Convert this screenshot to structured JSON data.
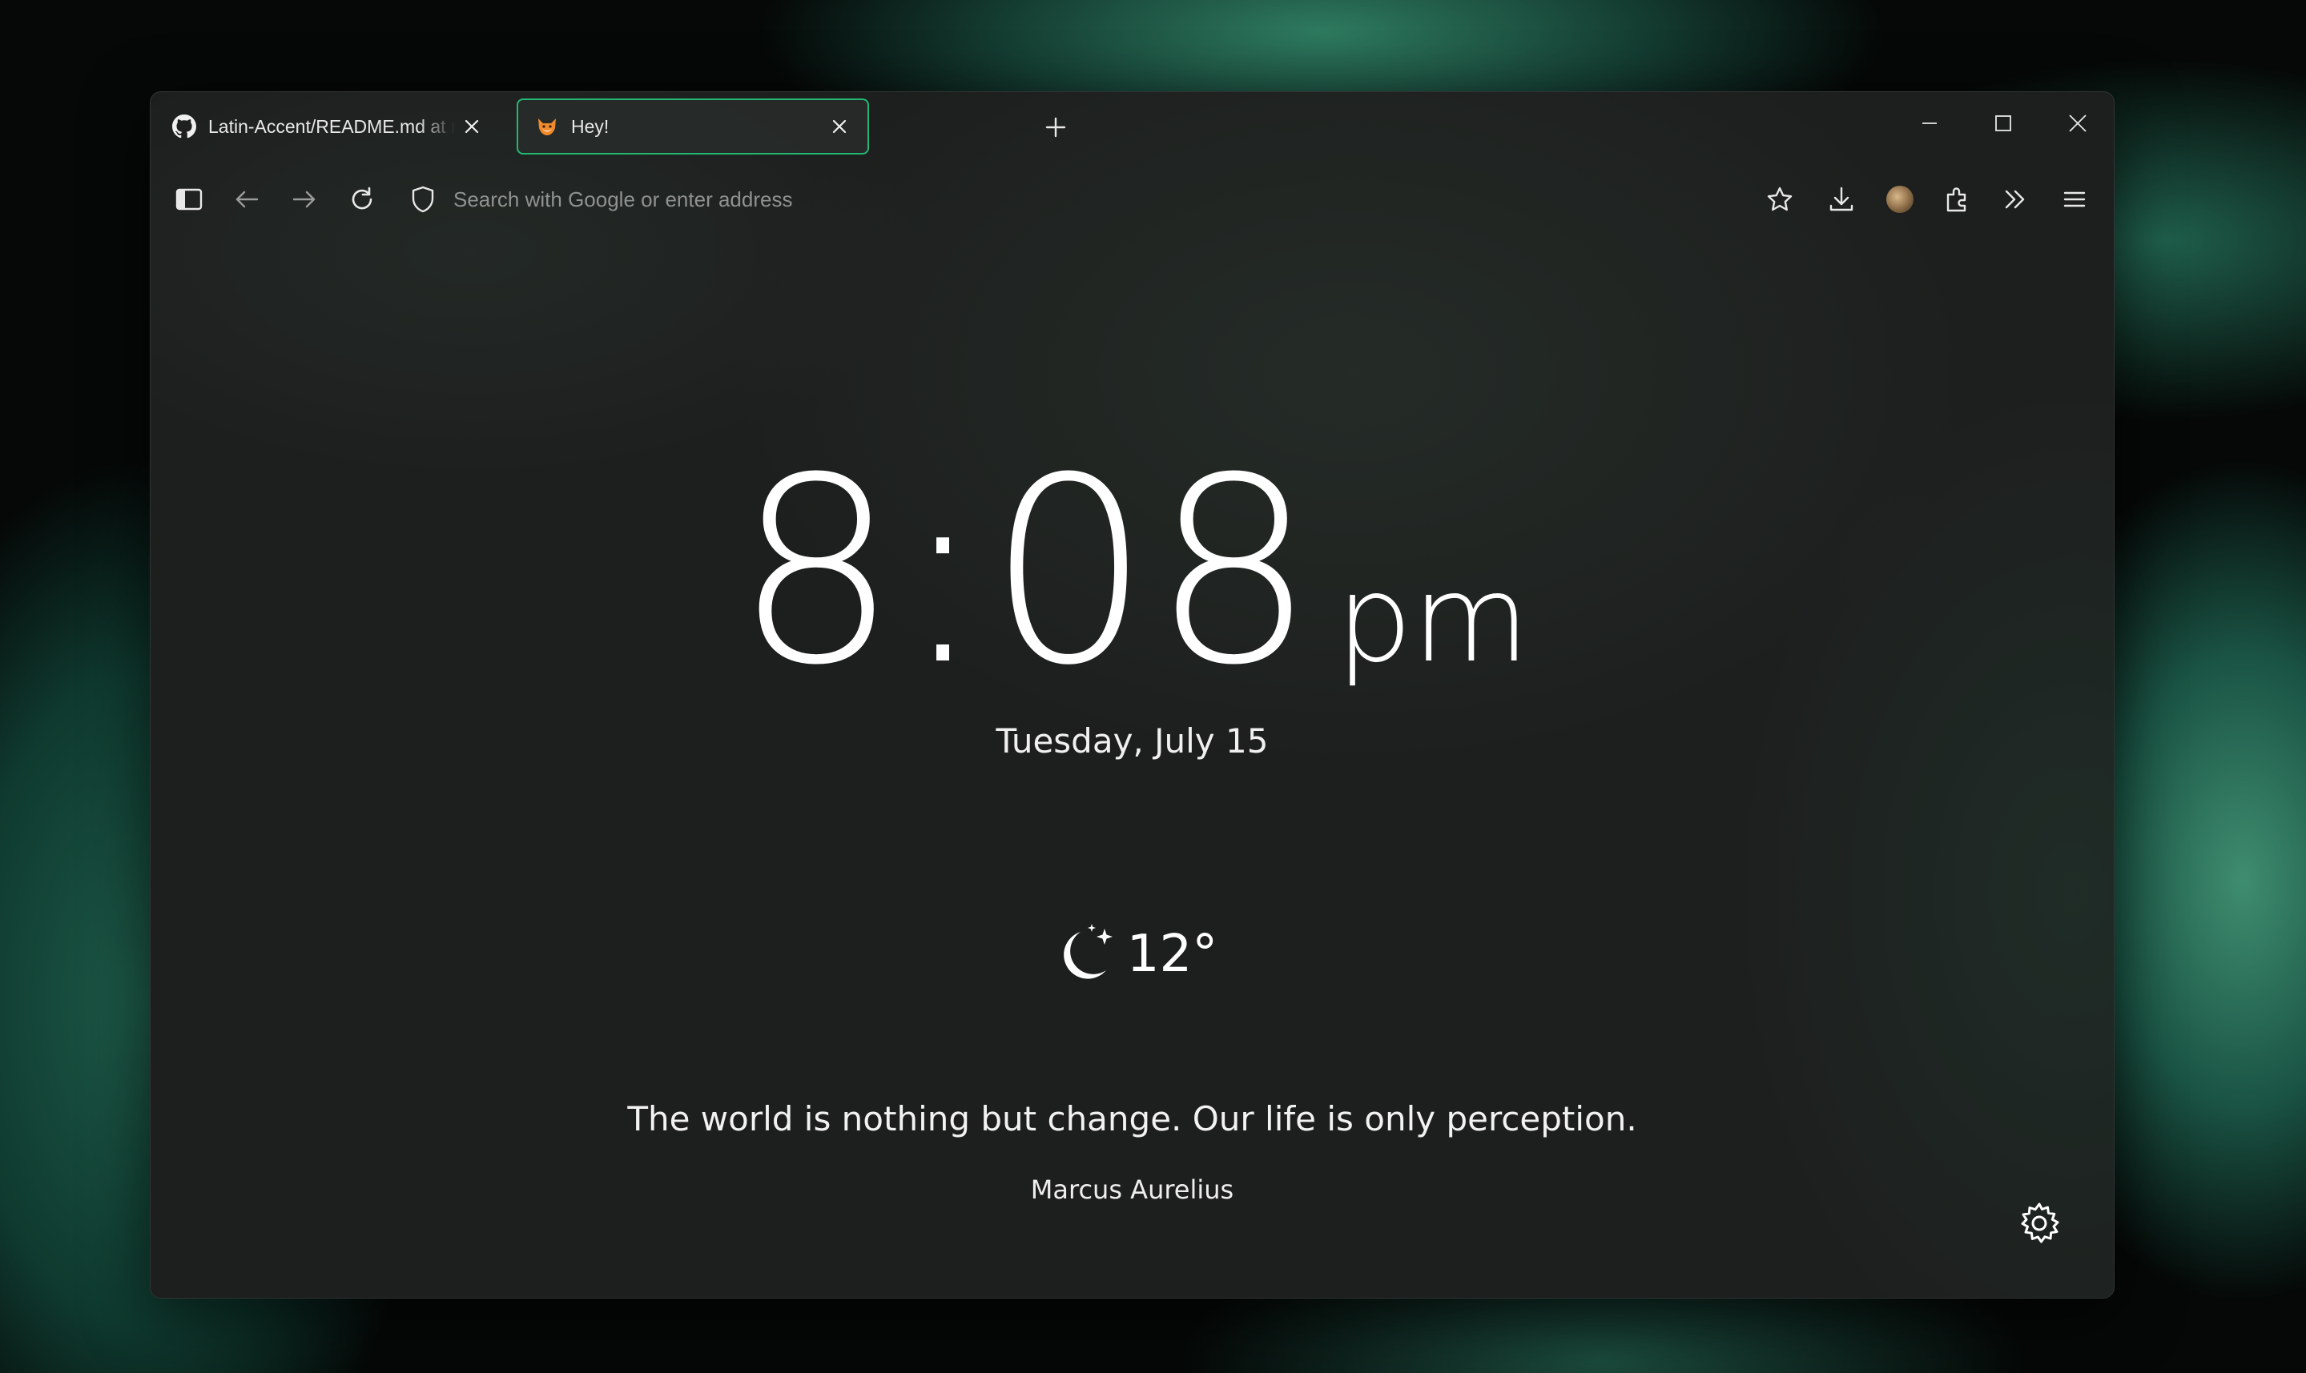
{
  "browser": {
    "tabs": [
      {
        "title": "Latin-Accent/README.md at main",
        "favicon": "github-icon",
        "active": false
      },
      {
        "title": "Hey!",
        "favicon": "fox-icon",
        "active": true
      }
    ],
    "address_placeholder": "Search with Google or enter address",
    "accent_color": "#22b874"
  },
  "newtab": {
    "time": "8:08",
    "ampm": "pm",
    "date": "Tuesday, July 15",
    "weather": {
      "icon": "moon-stars-icon",
      "temperature": "12°"
    },
    "quote": "The world is nothing but change. Our life is only perception.",
    "author": "Marcus Aurelius"
  }
}
